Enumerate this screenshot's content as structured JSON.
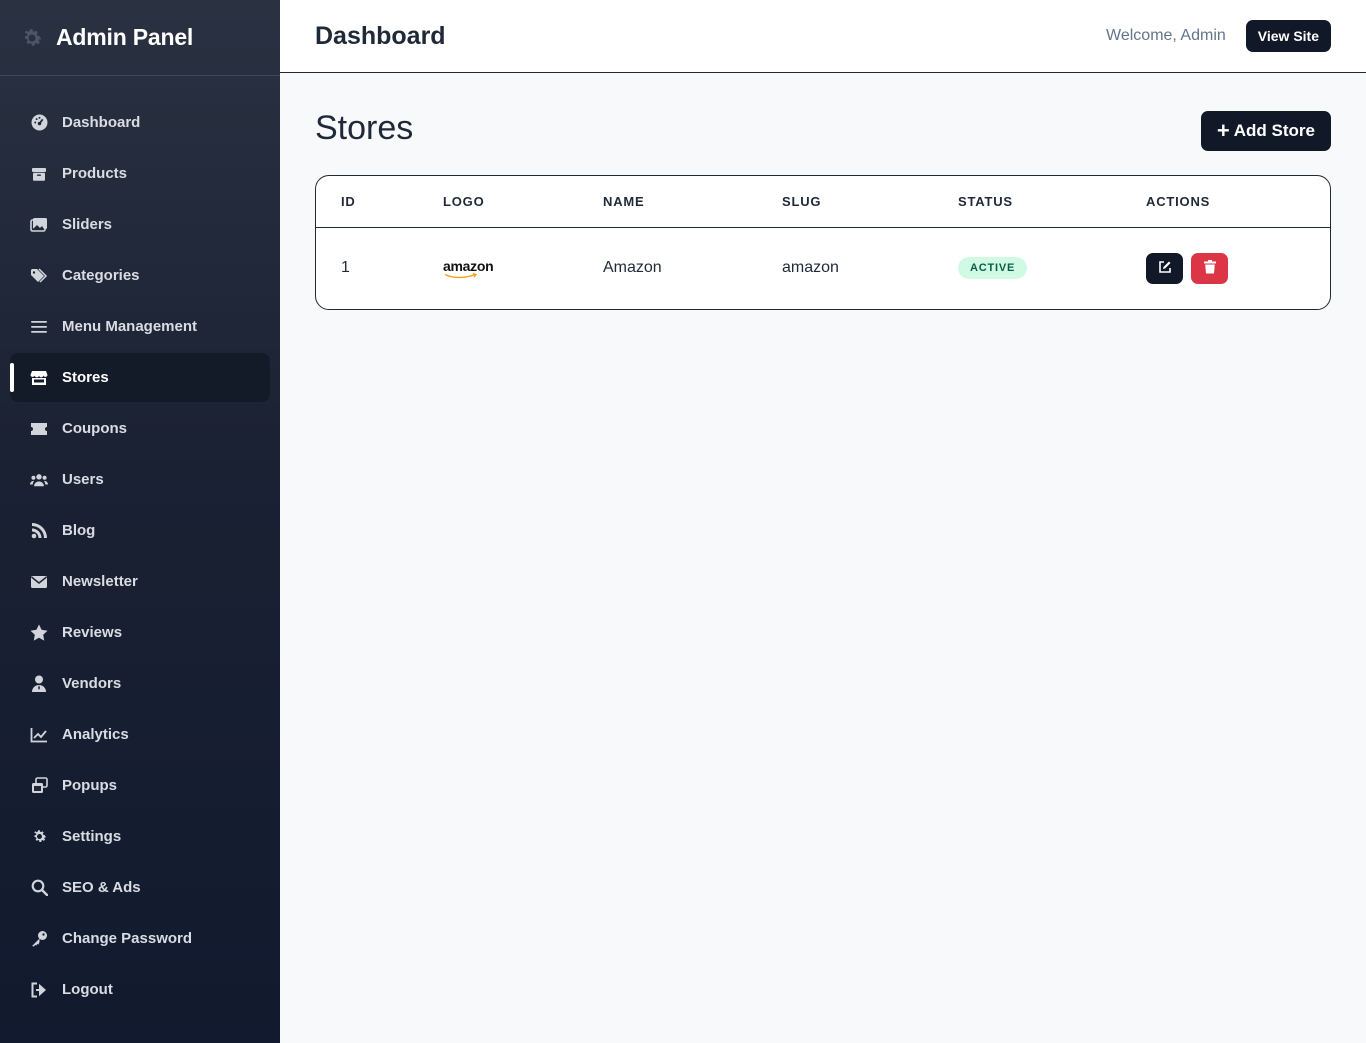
{
  "sidebar": {
    "brand_title": "Admin Panel",
    "items": [
      {
        "label": "Dashboard",
        "icon": "dashboard-icon"
      },
      {
        "label": "Products",
        "icon": "box-icon"
      },
      {
        "label": "Sliders",
        "icon": "images-icon"
      },
      {
        "label": "Categories",
        "icon": "tags-icon"
      },
      {
        "label": "Menu Management",
        "icon": "bars-icon"
      },
      {
        "label": "Stores",
        "icon": "store-icon",
        "active": true
      },
      {
        "label": "Coupons",
        "icon": "ticket-icon"
      },
      {
        "label": "Users",
        "icon": "users-icon"
      },
      {
        "label": "Blog",
        "icon": "blog-icon"
      },
      {
        "label": "Newsletter",
        "icon": "envelope-icon"
      },
      {
        "label": "Reviews",
        "icon": "star-icon"
      },
      {
        "label": "Vendors",
        "icon": "user-tie-icon"
      },
      {
        "label": "Analytics",
        "icon": "chart-line-icon"
      },
      {
        "label": "Popups",
        "icon": "window-restore-icon"
      },
      {
        "label": "Settings",
        "icon": "gear-icon"
      },
      {
        "label": "SEO & Ads",
        "icon": "search-icon"
      },
      {
        "label": "Change Password",
        "icon": "key-icon"
      },
      {
        "label": "Logout",
        "icon": "sign-out-icon"
      }
    ]
  },
  "topbar": {
    "page_title": "Dashboard",
    "welcome": "Welcome, Admin",
    "view_site_label": "View Site"
  },
  "main": {
    "section_title": "Stores",
    "add_store_label": "Add Store",
    "add_store_icon": "+",
    "table": {
      "headers": [
        "ID",
        "LOGO",
        "NAME",
        "SLUG",
        "STATUS",
        "ACTIONS"
      ],
      "rows": [
        {
          "id": "1",
          "logo_text": "amazon",
          "name": "Amazon",
          "slug": "amazon",
          "status": "ACTIVE"
        }
      ]
    }
  },
  "colors": {
    "accent_dark": "#111827",
    "danger": "#dc3545",
    "status_active_bg": "#d1fae5",
    "status_active_text": "#065f46"
  }
}
